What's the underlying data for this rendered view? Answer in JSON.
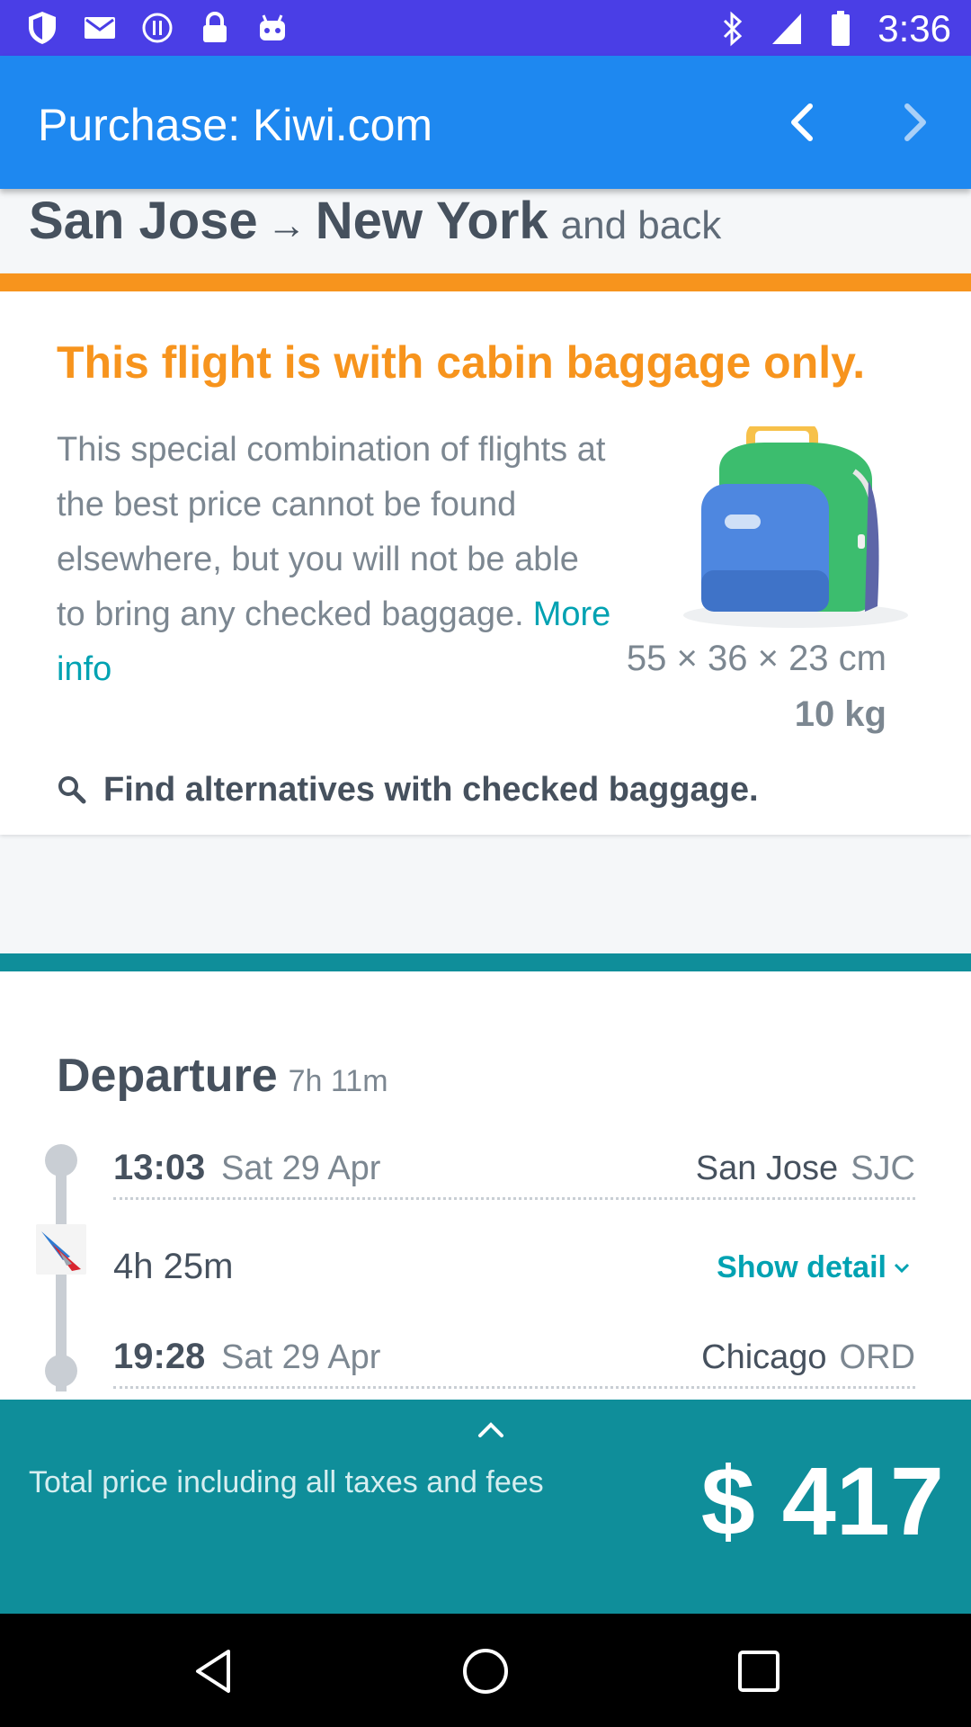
{
  "status_bar": {
    "time": "3:36",
    "icons": [
      "shield-icon",
      "mail-icon",
      "info-icon",
      "lock-icon",
      "android-icon",
      "bluetooth-icon",
      "signal-icon",
      "battery-icon"
    ]
  },
  "app_bar": {
    "title": "Purchase: Kiwi.com",
    "back_icon": "chevron-left-icon",
    "forward_icon": "chevron-right-icon"
  },
  "route": {
    "origin": "San Jose",
    "arrow": "→",
    "destination": "New York",
    "trip_type": "and back"
  },
  "baggage": {
    "title": "This flight is with cabin baggage only.",
    "description": "This special combination of flights at the best price cannot be found elsewhere, but you will not be able to bring any checked baggage.",
    "more_info": "More info",
    "dimensions": "55 × 36 × 23 cm",
    "weight": "10 kg",
    "find_alternatives": "Find alternatives with checked baggage.",
    "colors": {
      "accent": "#f7941d",
      "link": "#00a2b2"
    }
  },
  "departure": {
    "title": "Departure",
    "duration": "7h 11m",
    "segments": [
      {
        "time": "13:03",
        "date": "Sat 29 Apr",
        "city": "San Jose",
        "code": "SJC"
      },
      {
        "time": "19:28",
        "date": "Sat 29 Apr",
        "city": "Chicago",
        "code": "ORD"
      }
    ],
    "flight_duration": "4h 25m",
    "show_detail": "Show detail"
  },
  "price": {
    "label": "Total price including all taxes and fees",
    "value": "$ 417",
    "color": "#0f8e9a"
  },
  "nav_bar": {
    "icons": [
      "back-triangle-icon",
      "home-circle-icon",
      "recents-square-icon"
    ]
  }
}
